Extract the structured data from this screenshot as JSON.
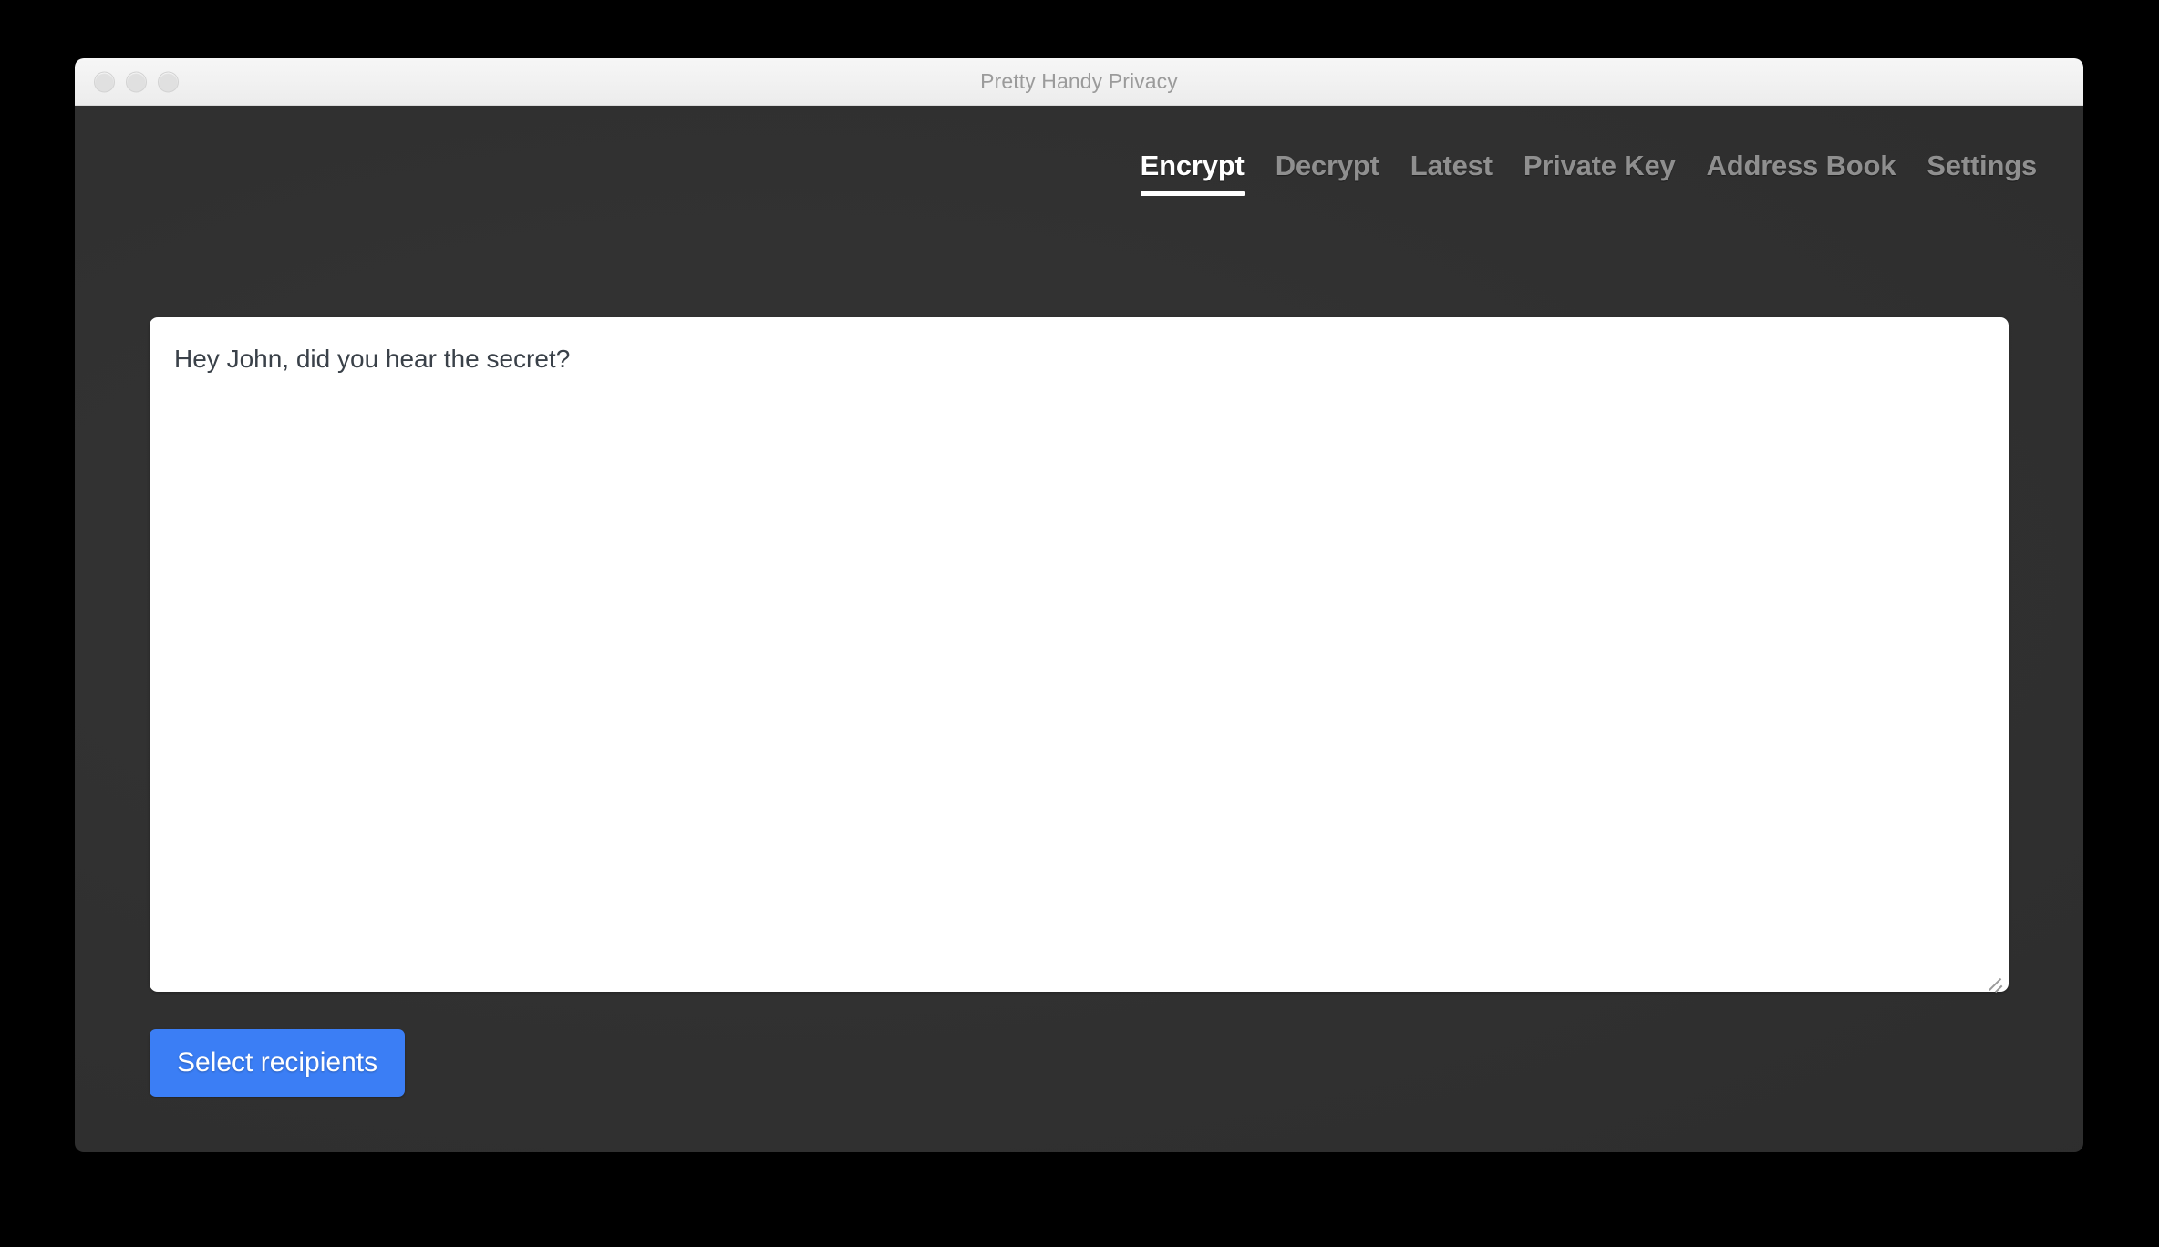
{
  "window": {
    "title": "Pretty Handy Privacy",
    "traffic_lights": [
      {
        "name": "close",
        "color": "#e0e0e0"
      },
      {
        "name": "minimize",
        "color": "#e0e0e0"
      },
      {
        "name": "zoom",
        "color": "#e0e0e0"
      }
    ]
  },
  "nav": {
    "tabs": [
      {
        "label": "Encrypt",
        "active": true
      },
      {
        "label": "Decrypt",
        "active": false
      },
      {
        "label": "Latest",
        "active": false
      },
      {
        "label": "Private Key",
        "active": false
      },
      {
        "label": "Address Book",
        "active": false
      },
      {
        "label": "Settings",
        "active": false
      }
    ]
  },
  "main": {
    "message": {
      "value": "Hey John, did you hear the secret?",
      "placeholder": ""
    },
    "select_recipients_label": "Select recipients"
  },
  "colors": {
    "accent": "#3b7ef5",
    "app_background": "#303030",
    "titlebar": "#f1f1f1",
    "title_text": "#9b9b9b",
    "tab_inactive": "#8f8f8f",
    "tab_active": "#ffffff",
    "textarea_background": "#ffffff",
    "textarea_text": "#3a4149",
    "desktop_background": "#000000"
  }
}
